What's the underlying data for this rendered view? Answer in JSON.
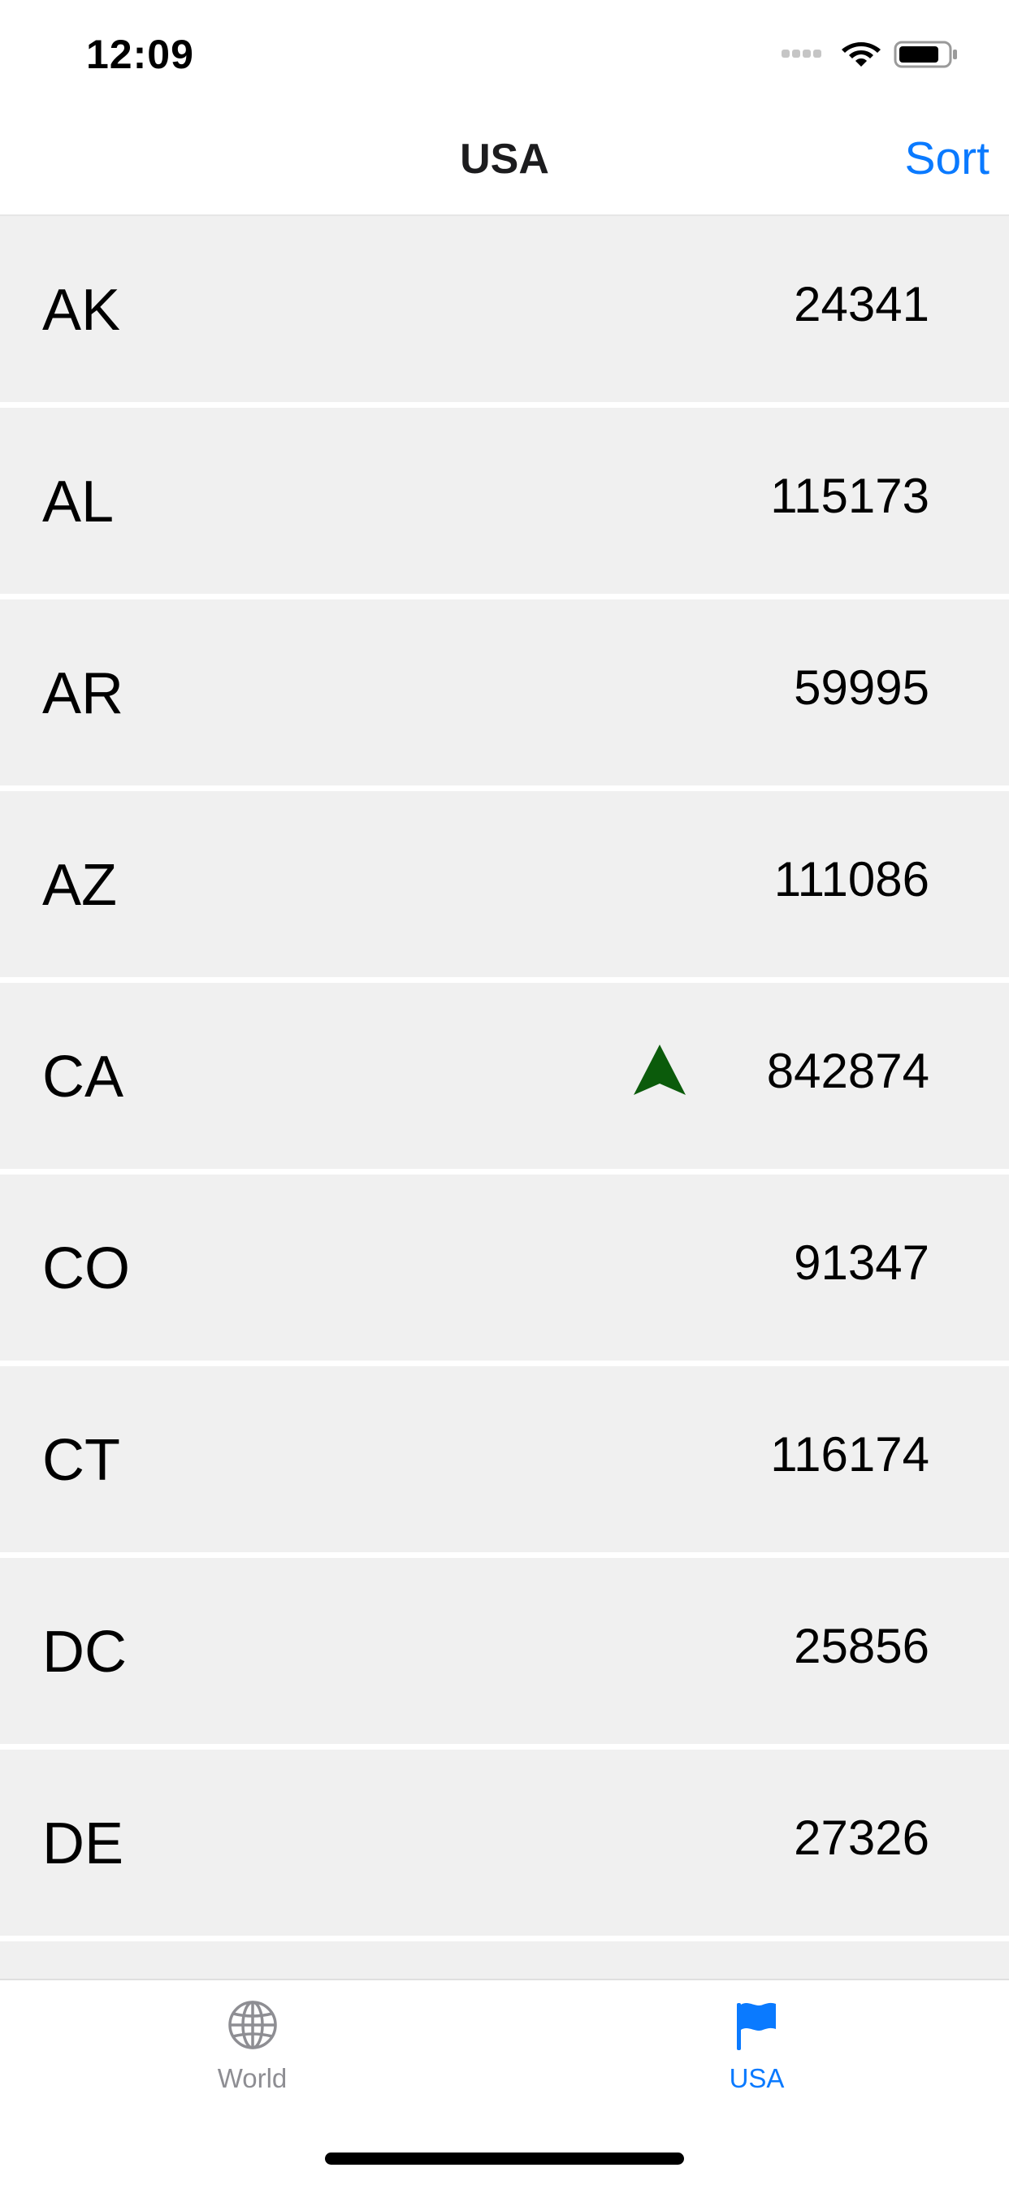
{
  "status_bar": {
    "time": "12:09"
  },
  "nav": {
    "title": "USA",
    "sort_label": "Sort"
  },
  "rows": [
    {
      "state": "AK",
      "value": "24341"
    },
    {
      "state": "AL",
      "value": "115173"
    },
    {
      "state": "AR",
      "value": "59995"
    },
    {
      "state": "AZ",
      "value": "111086"
    },
    {
      "state": "CA",
      "value": "842874",
      "trend_icon": "up-arrow-icon"
    },
    {
      "state": "CO",
      "value": "91347"
    },
    {
      "state": "CT",
      "value": "116174"
    },
    {
      "state": "DC",
      "value": "25856"
    },
    {
      "state": "DE",
      "value": "27326"
    }
  ],
  "tabs": [
    {
      "label": "World",
      "icon": "globe-icon",
      "selected": false
    },
    {
      "label": "USA",
      "icon": "flag-icon",
      "selected": true
    }
  ],
  "colors": {
    "accent": "#0a7aff",
    "trend_up": "#0b5b0b",
    "row_background": "#f0f0f0",
    "tab_inactive": "#8e8e93"
  }
}
